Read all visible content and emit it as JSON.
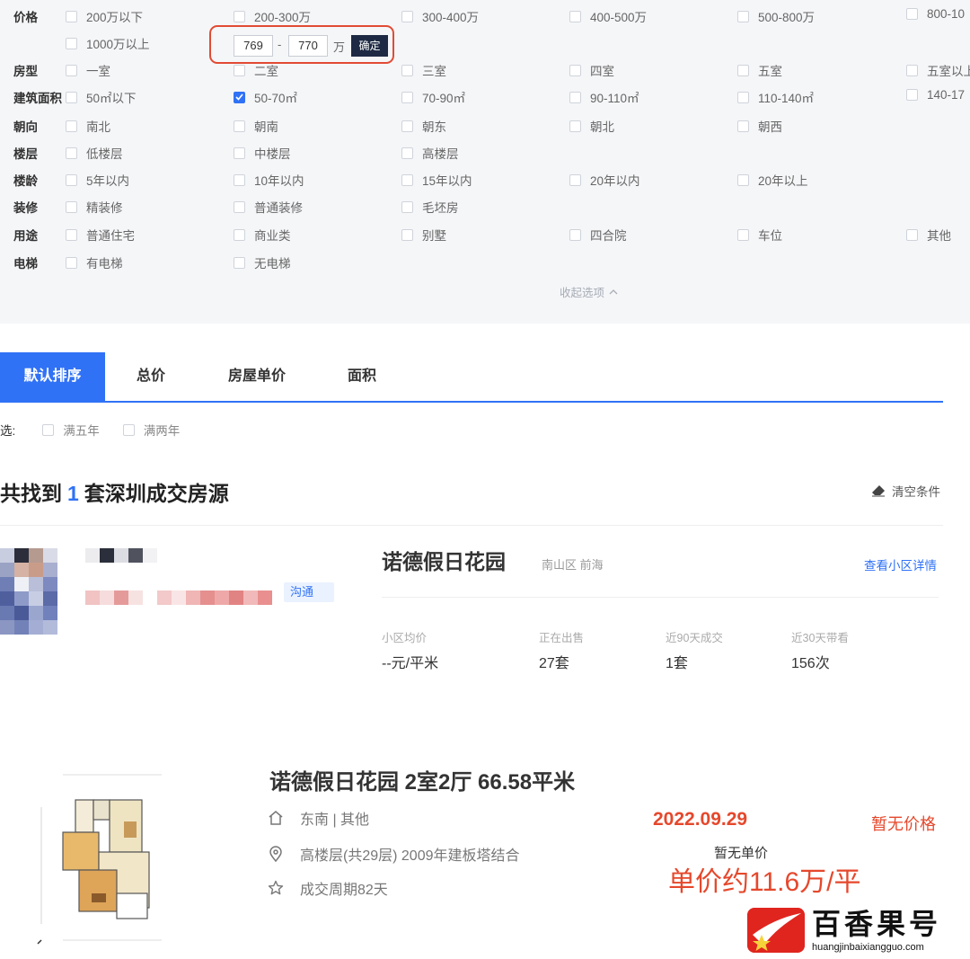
{
  "filters": [
    {
      "label": "价格",
      "options": [
        {
          "text": "200万以下",
          "checked": false
        },
        {
          "text": "200-300万",
          "checked": false
        },
        {
          "text": "300-400万",
          "checked": false
        },
        {
          "text": "400-500万",
          "checked": false
        },
        {
          "text": "500-800万",
          "checked": false
        },
        {
          "text": "800-10",
          "checked": false
        }
      ]
    },
    {
      "label": "",
      "options": [
        {
          "text": "1000万以上",
          "checked": false
        }
      ]
    },
    {
      "label": "房型",
      "options": [
        {
          "text": "一室",
          "checked": false
        },
        {
          "text": "二室",
          "checked": false
        },
        {
          "text": "三室",
          "checked": false
        },
        {
          "text": "四室",
          "checked": false
        },
        {
          "text": "五室",
          "checked": false
        },
        {
          "text": "五室以上",
          "checked": false
        }
      ]
    },
    {
      "label": "建筑面积",
      "options": [
        {
          "text": "50㎡以下",
          "checked": false
        },
        {
          "text": "50-70㎡",
          "checked": true
        },
        {
          "text": "70-90㎡",
          "checked": false
        },
        {
          "text": "90-110㎡",
          "checked": false
        },
        {
          "text": "110-140㎡",
          "checked": false
        },
        {
          "text": "140-17",
          "checked": false
        }
      ]
    },
    {
      "label": "朝向",
      "options": [
        {
          "text": "南北",
          "checked": false
        },
        {
          "text": "朝南",
          "checked": false
        },
        {
          "text": "朝东",
          "checked": false
        },
        {
          "text": "朝北",
          "checked": false
        },
        {
          "text": "朝西",
          "checked": false
        }
      ]
    },
    {
      "label": "楼层",
      "options": [
        {
          "text": "低楼层",
          "checked": false
        },
        {
          "text": "中楼层",
          "checked": false
        },
        {
          "text": "高楼层",
          "checked": false
        }
      ]
    },
    {
      "label": "楼龄",
      "options": [
        {
          "text": "5年以内",
          "checked": false
        },
        {
          "text": "10年以内",
          "checked": false
        },
        {
          "text": "15年以内",
          "checked": false
        },
        {
          "text": "20年以内",
          "checked": false
        },
        {
          "text": "20年以上",
          "checked": false
        }
      ]
    },
    {
      "label": "装修",
      "options": [
        {
          "text": "精装修",
          "checked": false
        },
        {
          "text": "普通装修",
          "checked": false
        },
        {
          "text": "毛坯房",
          "checked": false
        }
      ]
    },
    {
      "label": "用途",
      "options": [
        {
          "text": "普通住宅",
          "checked": false
        },
        {
          "text": "商业类",
          "checked": false
        },
        {
          "text": "别墅",
          "checked": false
        },
        {
          "text": "四合院",
          "checked": false
        },
        {
          "text": "车位",
          "checked": false
        },
        {
          "text": "其他",
          "checked": false
        }
      ]
    },
    {
      "label": "电梯",
      "options": [
        {
          "text": "有电梯",
          "checked": false
        },
        {
          "text": "无电梯",
          "checked": false
        }
      ]
    }
  ],
  "price_range": {
    "min": "769",
    "max": "770",
    "dash": "-",
    "unit": "万",
    "confirm_label": "确定"
  },
  "collapse_label": "收起选项",
  "sort_tabs": [
    {
      "label": "默认排序",
      "active": true
    },
    {
      "label": "总价",
      "active": false
    },
    {
      "label": "房屋单价",
      "active": false
    },
    {
      "label": "面积",
      "active": false
    }
  ],
  "quick_filter": {
    "label": "选:",
    "options": [
      "满五年",
      "满两年"
    ]
  },
  "result": {
    "prefix": "共找到",
    "count": "1",
    "suffix": "套深圳成交房源",
    "clear_label": "清空条件"
  },
  "agent": {
    "chat_label": "沟通"
  },
  "community": {
    "name": "诺德假日花园",
    "region": "南山区 前海",
    "detail_link": "查看小区详情",
    "stats": [
      {
        "key": "小区均价",
        "value": "--元/平米"
      },
      {
        "key": "正在出售",
        "value": "27套"
      },
      {
        "key": "近90天成交",
        "value": "1套"
      },
      {
        "key": "近30天带看",
        "value": "156次"
      }
    ]
  },
  "listing": {
    "title": "诺德假日花园 2室2厅 66.58平米",
    "orientation": "东南 | 其他",
    "floor": "高楼层(共29层) 2009年建板塔结合",
    "cycle": "成交周期82天",
    "deal_date": "2022.09.29",
    "total_price": "暂无价格",
    "unit_price_label": "暂无单价",
    "unit_price_approx": "单价约11.6万/平"
  },
  "watermark": {
    "text": "百香果号",
    "url": "huangjinbaixiangguo.com"
  },
  "colors": {
    "accent": "#3072f6",
    "price_red": "#e5482c",
    "highlight_box": "#e24b34",
    "panel_bg": "#f5f6f8"
  }
}
